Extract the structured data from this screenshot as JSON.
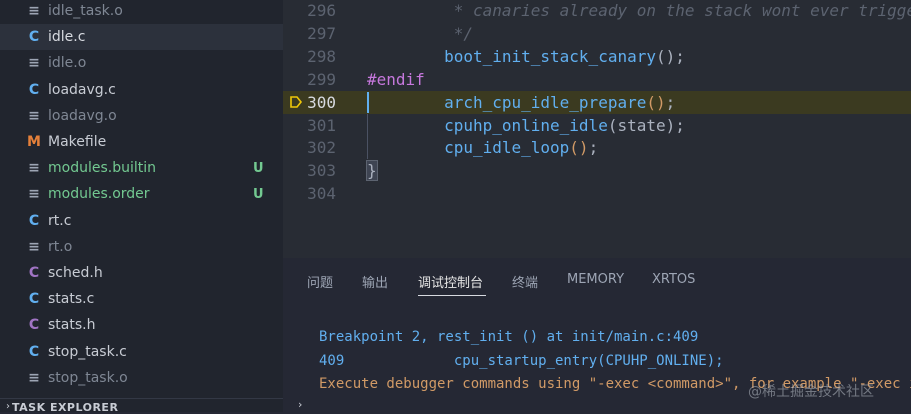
{
  "sidebar": {
    "files": [
      {
        "icon": "file-lines-icon",
        "glyph": "≡",
        "name": "idle_task.o",
        "color": "#7f8794",
        "icon_color": "#9da5b4",
        "badge": ""
      },
      {
        "icon": "c-file-icon",
        "glyph": "C",
        "name": "idle.c",
        "color": "#d7dae0",
        "icon_color": "#61afef",
        "badge": "",
        "selected": true
      },
      {
        "icon": "file-lines-icon",
        "glyph": "≡",
        "name": "idle.o",
        "color": "#7f8794",
        "icon_color": "#9da5b4",
        "badge": ""
      },
      {
        "icon": "c-file-icon",
        "glyph": "C",
        "name": "loadavg.c",
        "color": "#c8ccd4",
        "icon_color": "#61afef",
        "badge": ""
      },
      {
        "icon": "file-lines-icon",
        "glyph": "≡",
        "name": "loadavg.o",
        "color": "#7f8794",
        "icon_color": "#9da5b4",
        "badge": ""
      },
      {
        "icon": "makefile-icon",
        "glyph": "M",
        "name": "Makefile",
        "color": "#c8ccd4",
        "icon_color": "#e5803a",
        "badge": ""
      },
      {
        "icon": "file-lines-icon",
        "glyph": "≡",
        "name": "modules.builtin",
        "color": "#73c991",
        "icon_color": "#9da5b4",
        "badge": "U"
      },
      {
        "icon": "file-lines-icon",
        "glyph": "≡",
        "name": "modules.order",
        "color": "#73c991",
        "icon_color": "#9da5b4",
        "badge": "U"
      },
      {
        "icon": "c-file-icon",
        "glyph": "C",
        "name": "rt.c",
        "color": "#c8ccd4",
        "icon_color": "#61afef",
        "badge": ""
      },
      {
        "icon": "file-lines-icon",
        "glyph": "≡",
        "name": "rt.o",
        "color": "#7f8794",
        "icon_color": "#9da5b4",
        "badge": ""
      },
      {
        "icon": "c-header-icon",
        "glyph": "C",
        "name": "sched.h",
        "color": "#c8ccd4",
        "icon_color": "#a074c4",
        "badge": ""
      },
      {
        "icon": "c-file-icon",
        "glyph": "C",
        "name": "stats.c",
        "color": "#c8ccd4",
        "icon_color": "#61afef",
        "badge": ""
      },
      {
        "icon": "c-header-icon",
        "glyph": "C",
        "name": "stats.h",
        "color": "#c8ccd4",
        "icon_color": "#a074c4",
        "badge": ""
      },
      {
        "icon": "c-file-icon",
        "glyph": "C",
        "name": "stop_task.c",
        "color": "#c8ccd4",
        "icon_color": "#61afef",
        "badge": ""
      },
      {
        "icon": "file-lines-icon",
        "glyph": "≡",
        "name": "stop_task.o",
        "color": "#7f8794",
        "icon_color": "#9da5b4",
        "badge": ""
      }
    ],
    "badge_color": "#73c991",
    "section_title": "TASK EXPLORER"
  },
  "editor": {
    "lines": [
      {
        "num": "296",
        "tokens": [
          {
            "t": "         * canaries already on the stack wont ever trigger",
            "c": "c-comment"
          }
        ]
      },
      {
        "num": "297",
        "tokens": [
          {
            "t": "         */",
            "c": "c-comment"
          }
        ]
      },
      {
        "num": "298",
        "tokens": [
          {
            "t": "        ",
            "c": "c-plain"
          },
          {
            "t": "boot_init_stack_canary",
            "c": "c-fn"
          },
          {
            "t": "();",
            "c": "c-plain"
          }
        ]
      },
      {
        "num": "299",
        "tokens": [
          {
            "t": "#endif",
            "c": "c-macro"
          }
        ]
      },
      {
        "num": "300",
        "highlight": true,
        "breakpoint": true,
        "tokens": [
          {
            "t": "        ",
            "c": "c-plain"
          },
          {
            "t": "arch_cpu_idle_prepare",
            "c": "c-fn"
          },
          {
            "t": "()",
            "c": "c-paren"
          },
          {
            "t": ";",
            "c": "c-plain"
          }
        ]
      },
      {
        "num": "301",
        "tokens": [
          {
            "t": "        ",
            "c": "c-plain"
          },
          {
            "t": "cpuhp_online_idle",
            "c": "c-fn"
          },
          {
            "t": "(state);",
            "c": "c-plain"
          }
        ]
      },
      {
        "num": "302",
        "tokens": [
          {
            "t": "        ",
            "c": "c-plain"
          },
          {
            "t": "cpu_idle_loop",
            "c": "c-fn"
          },
          {
            "t": "()",
            "c": "c-paren"
          },
          {
            "t": ";",
            "c": "c-plain"
          }
        ]
      },
      {
        "num": "303",
        "tokens": [
          {
            "t": "}",
            "c": "c-brace"
          }
        ]
      },
      {
        "num": "304",
        "tokens": []
      }
    ]
  },
  "panel": {
    "tabs": [
      {
        "label": "问题",
        "name": "tab-problems"
      },
      {
        "label": "输出",
        "name": "tab-output"
      },
      {
        "label": "调试控制台",
        "name": "tab-debug-console",
        "active": true
      },
      {
        "label": "终端",
        "name": "tab-terminal"
      },
      {
        "label": "MEMORY",
        "name": "tab-memory"
      },
      {
        "label": "XRTOS",
        "name": "tab-xrtos"
      }
    ],
    "output": [
      {
        "text": "Breakpoint 2, rest_init () at init/main.c:409",
        "kind": "info"
      },
      {
        "text": "409             cpu_startup_entry(CPUHP_ONLINE);",
        "kind": "info"
      },
      {
        "text": "Execute debugger commands using \"-exec <command>\", for example \"-exec i",
        "kind": "warn"
      }
    ]
  },
  "watermark": "@稀土掘金技术社区"
}
